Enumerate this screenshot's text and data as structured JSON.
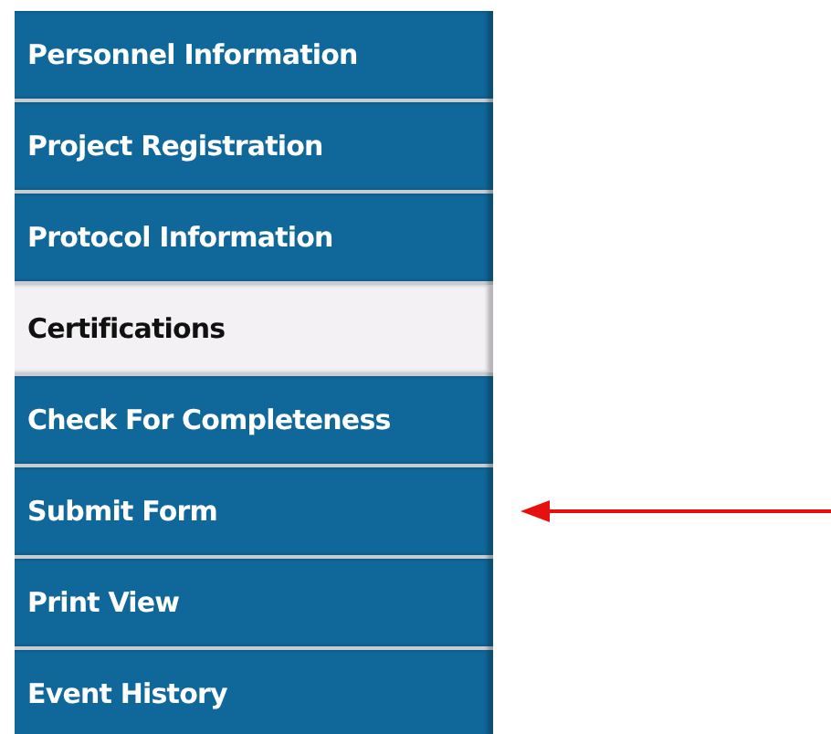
{
  "menu": {
    "items": [
      {
        "label": "Personnel Information",
        "selected": false,
        "arrow": false
      },
      {
        "label": "Project Registration",
        "selected": false,
        "arrow": false
      },
      {
        "label": "Protocol Information",
        "selected": false,
        "arrow": false
      },
      {
        "label": "Certifications",
        "selected": true,
        "arrow": false
      },
      {
        "label": "Check For Completeness",
        "selected": false,
        "arrow": false
      },
      {
        "label": "Submit Form",
        "selected": false,
        "arrow": true
      },
      {
        "label": "Print View",
        "selected": false,
        "arrow": false
      },
      {
        "label": "Event History",
        "selected": false,
        "arrow": false
      }
    ]
  }
}
